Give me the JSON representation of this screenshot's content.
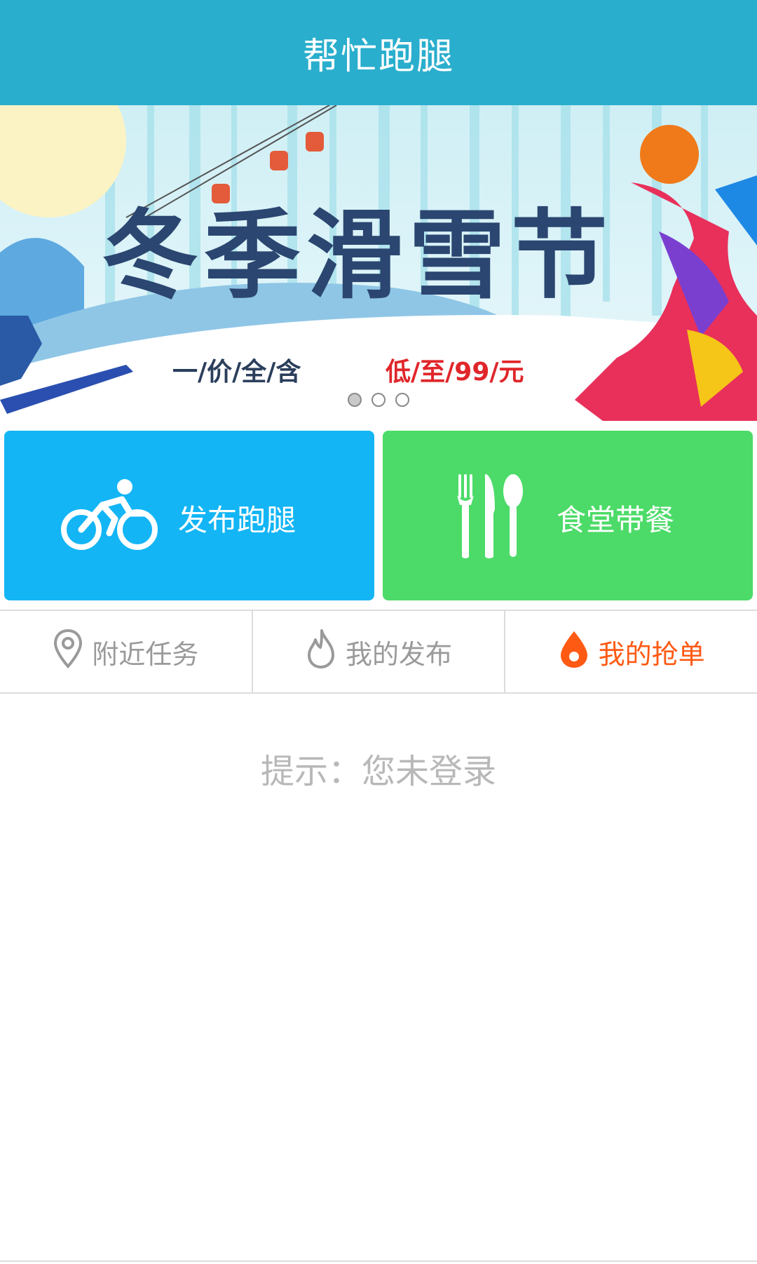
{
  "header": {
    "title": "帮忙跑腿"
  },
  "banner": {
    "headline": "冬季滑雪节",
    "tagline_left": "一/价/全/含",
    "tagline_right": "低/至/99/元",
    "dots_count": 3,
    "active_dot": 0
  },
  "actions": [
    {
      "label": "发布跑腿",
      "icon": "bicycle-icon",
      "color": "#13b5f5"
    },
    {
      "label": "食堂带餐",
      "icon": "cutlery-icon",
      "color": "#4cdb68"
    }
  ],
  "tabs": [
    {
      "label": "附近任务",
      "icon": "location-pin-icon",
      "active": false
    },
    {
      "label": "我的发布",
      "icon": "flame-outline-icon",
      "active": false
    },
    {
      "label": "我的抢单",
      "icon": "drop-icon",
      "active": true
    }
  ],
  "hint": "提示：您未登录",
  "colors": {
    "header": "#2aaecd",
    "active_tab": "#ff5a14",
    "inactive_text": "#9a9a9a",
    "hint_text": "#b8b8b8"
  }
}
